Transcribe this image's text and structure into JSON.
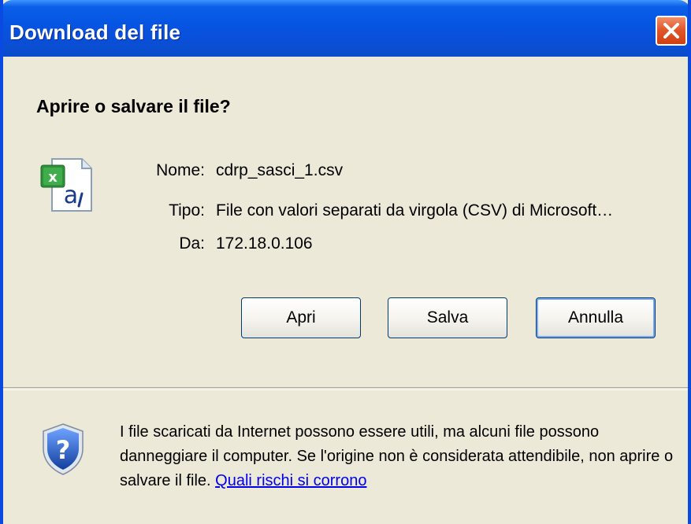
{
  "window": {
    "title": "Download del file"
  },
  "dialog": {
    "question": "Aprire o salvare il file?",
    "fields": [
      {
        "label": "Nome:",
        "value": "cdrp_sasci_1.csv"
      },
      {
        "label": "Tipo:",
        "value": "File con valori separati da virgola (CSV) di Microsoft…"
      },
      {
        "label": "Da:",
        "value": "172.18.0.106"
      }
    ],
    "buttons": {
      "open": "Apri",
      "save": "Salva",
      "cancel": "Annulla"
    }
  },
  "warning": {
    "text": "I file scaricati da Internet possono essere utili, ma alcuni file possono danneggiare il computer. Se l'origine non è considerata attendibile, non aprire o salvare il file. ",
    "link": "Quali rischi si corrono"
  },
  "icons": {
    "file": "excel-csv-file-icon",
    "security": "shield-question-icon",
    "close": "close-icon"
  },
  "colors": {
    "titlebar": "#0654e2",
    "close_button": "#e2572c",
    "dialog_bg": "#ece9d8",
    "link": "#0000ee"
  }
}
